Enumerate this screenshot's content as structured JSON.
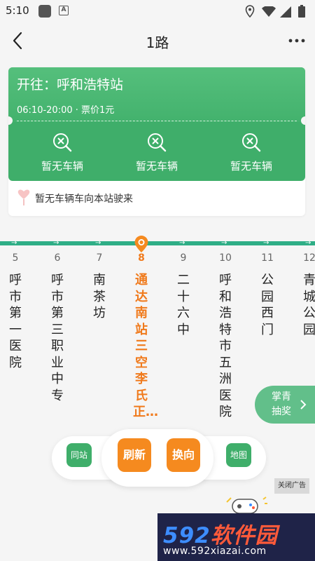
{
  "status_bar": {
    "time": "5:10",
    "app_badge": "A"
  },
  "nav": {
    "title": "1路"
  },
  "card": {
    "destination": "开往：呼和浩特站",
    "hours_price": "06:10-20:00 · 票价1元",
    "vehicles": [
      "暂无车辆",
      "暂无车辆",
      "暂无车辆"
    ],
    "arrival_notice": "暂无车辆车向本站驶来"
  },
  "route": {
    "line_color": "#2fae86",
    "active_color": "#f07a1c",
    "stops": [
      {
        "num": "5",
        "name": "呼市第一医院"
      },
      {
        "num": "6",
        "name": "呼市第三职业中专"
      },
      {
        "num": "7",
        "name": "南茶坊"
      },
      {
        "num": "8",
        "name": "通达南站三空李氏正…",
        "active": true
      },
      {
        "num": "9",
        "name": "二十六中"
      },
      {
        "num": "10",
        "name": "呼和浩特市五洲医院"
      },
      {
        "num": "11",
        "name": "公园西门"
      },
      {
        "num": "12",
        "name": "青城公园"
      }
    ]
  },
  "float": {
    "lottery_line1": "掌青",
    "lottery_line2": "抽奖"
  },
  "controls": {
    "same_station": "同站",
    "refresh": "刷新",
    "reverse": "换向",
    "map": "地图",
    "close_ad": "关闭广告"
  },
  "watermark": {
    "num": "592",
    "text": "软件园",
    "url": "www.592xiazai.com"
  },
  "colors": {
    "green": "#3fae6a",
    "orange": "#f58a1f",
    "bg": "#f5f5f5"
  }
}
